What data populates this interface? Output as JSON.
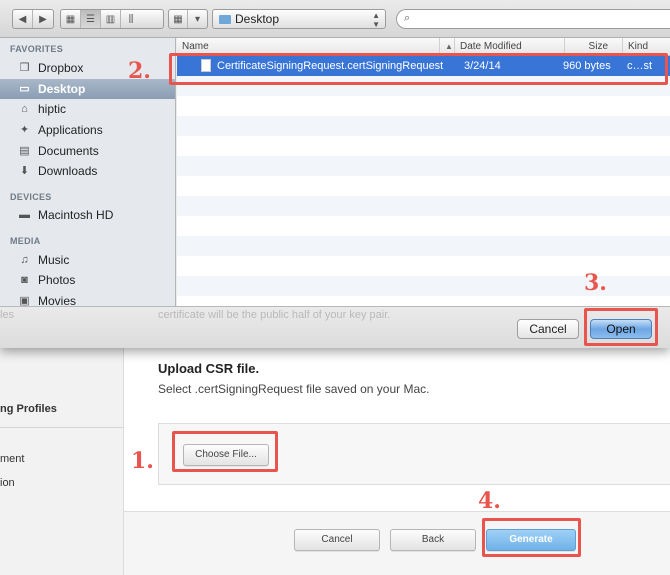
{
  "toolbar": {
    "location": "Desktop",
    "search_placeholder": ""
  },
  "sidebar": {
    "favorites_header": "FAVORITES",
    "favorites": [
      {
        "label": "Dropbox",
        "icon": "dropbox-icon"
      },
      {
        "label": "Desktop",
        "icon": "desktop-icon",
        "selected": true
      },
      {
        "label": "hiptic",
        "icon": "home-icon"
      },
      {
        "label": "Applications",
        "icon": "applications-icon"
      },
      {
        "label": "Documents",
        "icon": "documents-icon"
      },
      {
        "label": "Downloads",
        "icon": "downloads-icon"
      }
    ],
    "devices_header": "DEVICES",
    "devices": [
      {
        "label": "Macintosh HD",
        "icon": "hard-drive-icon"
      }
    ],
    "media_header": "MEDIA",
    "media": [
      {
        "label": "Music",
        "icon": "music-icon"
      },
      {
        "label": "Photos",
        "icon": "photos-icon"
      },
      {
        "label": "Movies",
        "icon": "movies-icon"
      }
    ]
  },
  "file_list": {
    "columns": {
      "name": "Name",
      "date": "Date Modified",
      "size": "Size",
      "kind": "Kind"
    },
    "files": [
      {
        "name": "CertificateSigningRequest.certSigningRequest",
        "date": "3/24/14",
        "size": "960 bytes",
        "kind": "c…st",
        "selected": true
      }
    ]
  },
  "sheet_buttons": {
    "cancel": "Cancel",
    "open": "Open"
  },
  "background": {
    "partial_text": "certificate will be the public half of your key pair.",
    "partial_left_text": "les",
    "left_nav": [
      "ng Profiles",
      "ment",
      "ion"
    ],
    "upload_title": "Upload CSR file.",
    "upload_desc": "Select .certSigningRequest file saved on your Mac.",
    "choose_file": "Choose File...",
    "footer": {
      "cancel": "Cancel",
      "back": "Back",
      "generate": "Generate"
    }
  },
  "annotations": {
    "step1": "1.",
    "step2": "2.",
    "step3": "3.",
    "step4": "4."
  },
  "colors": {
    "highlight": "#e8554e",
    "selection": "#3875d7",
    "sidebar_bg": "#e5e9ee"
  }
}
